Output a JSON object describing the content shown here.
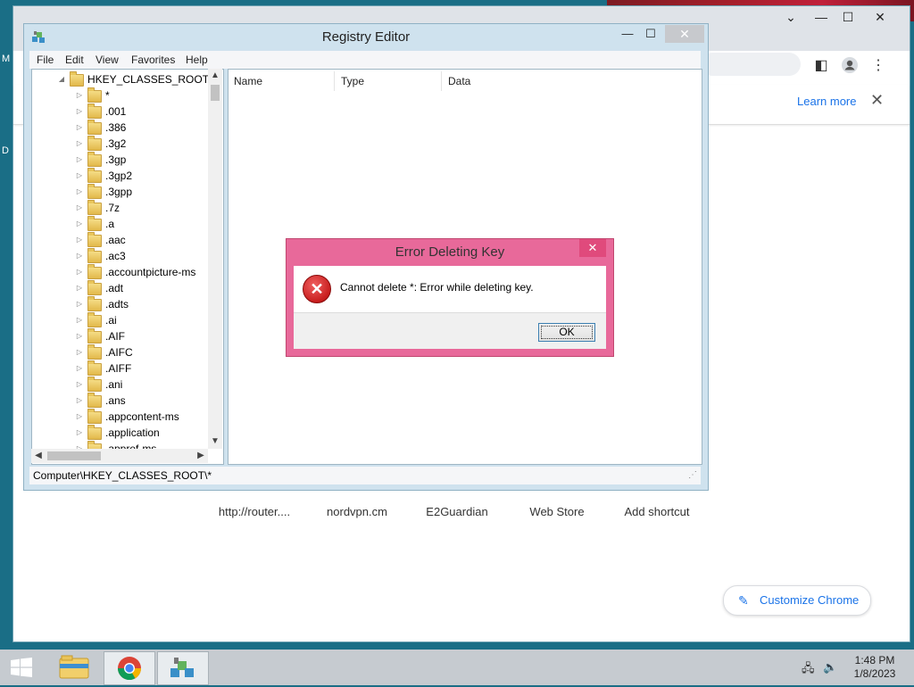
{
  "desktop": {
    "left_letters": [
      "M",
      "D"
    ]
  },
  "browser": {
    "window_controls": {
      "dropdown": "⌄",
      "minimize": "—",
      "maximize": "☐",
      "close": "✕"
    },
    "infobar": {
      "learn_more": "Learn more"
    },
    "shortcuts": [
      "http://router....",
      "nordvpn.cm",
      "E2Guardian",
      "Web Store",
      "Add shortcut"
    ],
    "customize_label": "Customize Chrome"
  },
  "regedit": {
    "title": "Registry Editor",
    "menu": [
      "File",
      "Edit",
      "View",
      "Favorites",
      "Help"
    ],
    "tree": {
      "root": "HKEY_CLASSES_ROOT",
      "items": [
        "*",
        ".001",
        ".386",
        ".3g2",
        ".3gp",
        ".3gp2",
        ".3gpp",
        ".7z",
        ".a",
        ".aac",
        ".ac3",
        ".accountpicture-ms",
        ".adt",
        ".adts",
        ".ai",
        ".AIF",
        ".AIFC",
        ".AIFF",
        ".ani",
        ".ans",
        ".appcontent-ms",
        ".application",
        ".appref-ms"
      ]
    },
    "columns": [
      "Name",
      "Type",
      "Data"
    ],
    "status_path": "Computer\\HKEY_CLASSES_ROOT\\*"
  },
  "dialog": {
    "title": "Error Deleting Key",
    "message": "Cannot delete *:  Error while deleting key.",
    "ok_label": "OK"
  },
  "taskbar": {
    "time": "1:48 PM",
    "date": "1/8/2023"
  },
  "colors": {
    "dialog_frame": "#e8699a",
    "regedit_frame": "#cfe2ee",
    "desktop": "#1a6e86",
    "link_blue": "#1a73e8"
  }
}
